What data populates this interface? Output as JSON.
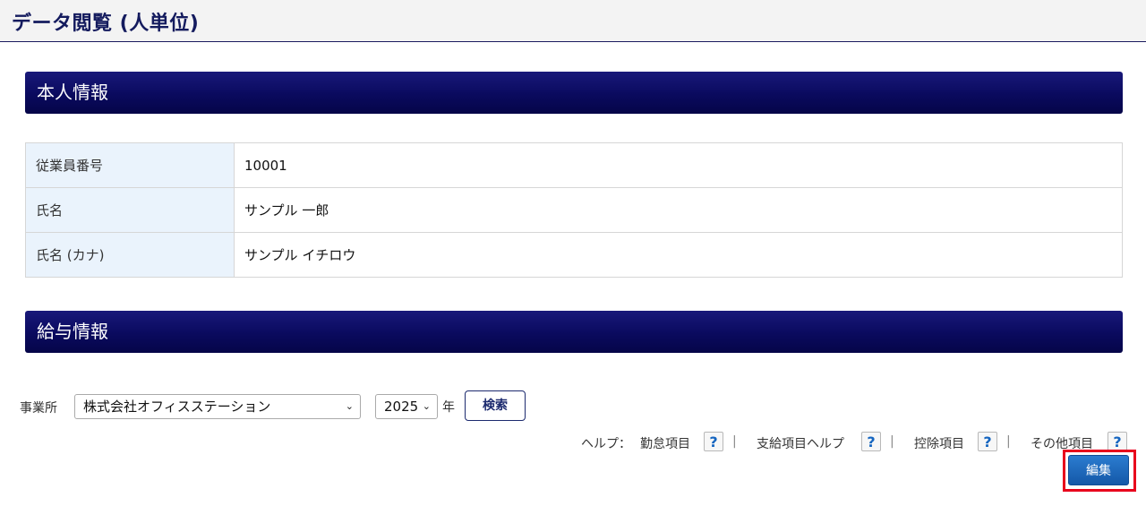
{
  "page": {
    "title": "データ閲覧 (人単位)"
  },
  "sections": {
    "personal": "本人情報",
    "salary": "給与情報"
  },
  "personal_info": {
    "rows": [
      {
        "label": "従業員番号",
        "value": "10001"
      },
      {
        "label": "氏名",
        "value": "サンプル 一郎"
      },
      {
        "label": "氏名 (カナ)",
        "value": "サンプル イチロウ"
      }
    ]
  },
  "filters": {
    "office_label": "事業所",
    "office_value": "株式会社オフィスステーション",
    "year_value": "2025",
    "year_suffix": "年",
    "search_label": "検索"
  },
  "help": {
    "prefix": "ヘルプ：",
    "items": [
      "勤怠項目",
      "支給項目ヘルプ",
      "控除項目",
      "その他項目"
    ],
    "icon_text": "?",
    "separator": "|"
  },
  "actions": {
    "edit_label": "編集"
  },
  "colors": {
    "header_navy": "#0a0a5e",
    "label_bg": "#eaf3fc",
    "edit_blue": "#1a64b8",
    "highlight_red": "#e8001c"
  }
}
